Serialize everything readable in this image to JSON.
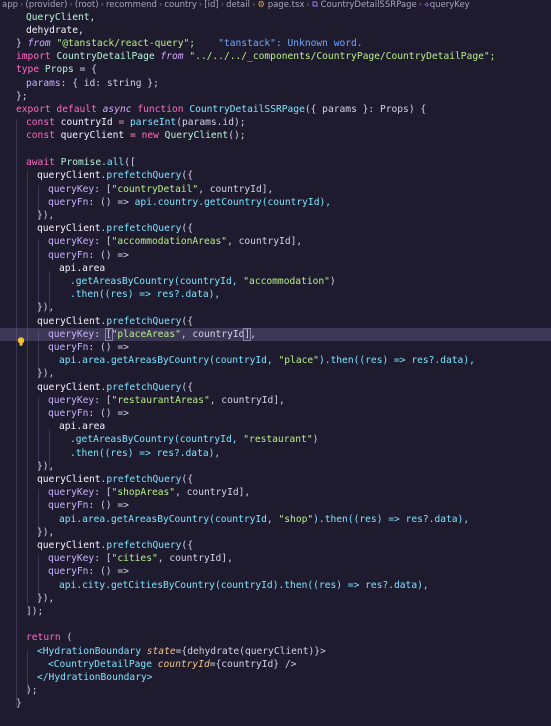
{
  "breadcrumb": {
    "items": [
      "app",
      "(provider)",
      "(root)",
      "recommend",
      "country",
      "[id]",
      "detail",
      "page.tsx",
      "CountryDetailSSRPage",
      "queryKey"
    ]
  },
  "hint": {
    "text": "\"tanstack\": Unknown word."
  },
  "colors": {
    "background": "#1e1b2e",
    "keyword": "#ff6ac1",
    "function": "#7ee2ff",
    "string": "#b7ef86",
    "type": "#b7f4d6"
  },
  "code": {
    "l1": "QueryClient,",
    "l2": "dehydrate,",
    "l3_brace": "}",
    "l3_from": "from",
    "l3_str": "\"@tanstack/react-query\";",
    "l4_import": "import",
    "l4_name": "CountryDetailPage",
    "l4_from": "from",
    "l4_str": "\"../../../_components/CountryPage/CountryDetailPage\";",
    "l5_type": "type",
    "l5_name": "Props",
    "l5_rest": "= {",
    "l6_prop": "params",
    "l6_rest": ": { id: string };",
    "l7": "};",
    "l8_export": "export default",
    "l8_async": "async",
    "l8_function": "function",
    "l8_name": "CountryDetailSSRPage",
    "l8_rest": "({ params }: Props) {",
    "l9_const": "const",
    "l9_var": "countryId",
    "l9_eq": "=",
    "l9_fn": "parseInt",
    "l9_rest": "(params.id);",
    "l10_const": "const",
    "l10_var": "queryClient",
    "l10_eq": "=",
    "l10_new": "new",
    "l10_cls": "QueryClient",
    "l10_rest": "();",
    "l12_await": "await",
    "l12_cls": "Promise",
    "l12_fn": ".all",
    "l12_rest": "([",
    "prefetch_obj": "queryClient",
    "prefetch_fn": ".prefetchQuery",
    "prefetch_open": "({",
    "queryKey": "queryKey",
    "queryFn": "queryFn",
    "arrow": ": () =>",
    "close_obj": "}),",
    "q1_key": "\"countryDetail\"",
    "q1_fn_body": "api.country.getCountry(countryId),",
    "q2_key": "\"accommodationAreas\"",
    "q2_api": "api.area",
    "q2_get": ".getAreasByCountry(countryId, ",
    "q2_str": "\"accommodation\"",
    "q2_then": ".then((res) => res?.data),",
    "q3_key": "\"placeAreas\"",
    "q3_api": "api.area.getAreasByCountry(countryId, ",
    "q3_str": "\"place\"",
    "q3_then": ").then((res) => res?.data),",
    "q4_key": "\"restaurantAreas\"",
    "q4_str": "\"restaurant\"",
    "q5_key": "\"shopAreas\"",
    "q5_str": "\"shop\"",
    "q6_key": "\"cities\"",
    "q6_body": "api.city.getCitiesByCountry(countryId).then((res) => res?.data),",
    "end_all": "]);",
    "ret": "return",
    "ret_paren": "(",
    "hb_open": "<HydrationBoundary",
    "hb_attr": "state",
    "hb_val": "={dehydrate(queryClient)}>",
    "cdp_open": "<CountryDetailPage",
    "cdp_attr": "countryId",
    "cdp_val": "={countryId} />",
    "hb_close": "</HydrationBoundary>",
    "ret_close": ");",
    "fn_close": "}"
  }
}
